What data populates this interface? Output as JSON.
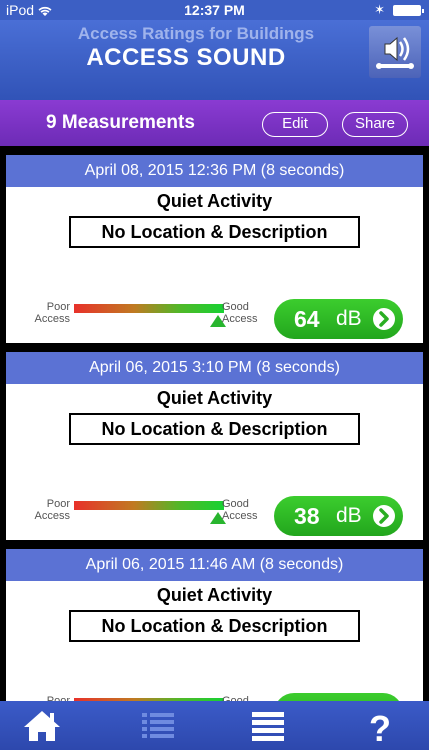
{
  "status_bar": {
    "carrier": "iPod",
    "time": "12:37 PM"
  },
  "header": {
    "subtitle": "Access Ratings for Buildings",
    "title": "ACCESS SOUND",
    "icon": "speaker-icon"
  },
  "toolbar": {
    "count_label": "9 Measurements",
    "edit_label": "Edit",
    "share_label": "Share"
  },
  "meter_labels": {
    "poor_line1": "Poor",
    "poor_line2": "Access",
    "good_line1": "Good",
    "good_line2": "Access"
  },
  "measurements": [
    {
      "date": "April 08, 2015  12:36 PM (8 seconds)",
      "activity": "Quiet Activity",
      "location": "No Location & Description",
      "value": "64",
      "unit": "dB",
      "rating_fraction": 0.96
    },
    {
      "date": "April 06, 2015  3:10 PM (8 seconds)",
      "activity": "Quiet Activity",
      "location": "No Location & Description",
      "value": "38",
      "unit": "dB",
      "rating_fraction": 0.96
    },
    {
      "date": "April 06, 2015  11:46 AM (8 seconds)",
      "activity": "Quiet Activity",
      "location": "No Location & Description",
      "value": "",
      "unit": "",
      "rating_fraction": 0.96
    }
  ],
  "tabbar": {
    "items": [
      "home-icon",
      "list-icon",
      "menu-icon",
      "help-icon"
    ]
  },
  "colors": {
    "header_blue": "#3c5fc4",
    "toolbar_purple": "#7a32c4",
    "card_date_bar": "#5b72d4",
    "good_green": "#2fbf25"
  }
}
